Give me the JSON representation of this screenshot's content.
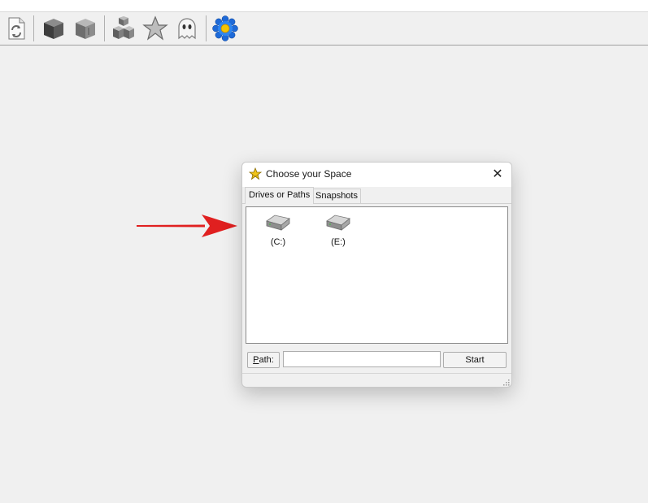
{
  "toolbar": {
    "buttons": [
      {
        "icon": "refresh-document-icon"
      },
      {
        "icon": "dark-cube-icon"
      },
      {
        "icon": "gray-cube-icon"
      },
      {
        "icon": "cubes-icon"
      },
      {
        "icon": "star-icon"
      },
      {
        "icon": "ghost-icon"
      },
      {
        "icon": "blue-flower-icon"
      }
    ]
  },
  "annotation": {
    "arrow_color": "#e02020"
  },
  "dialog": {
    "title": "Choose your Space",
    "close_label": "✕",
    "tabs": [
      {
        "label": "Drives or Paths",
        "active": true
      },
      {
        "label": "Snapshots",
        "active": false
      }
    ],
    "drives": [
      {
        "label": "(C:)",
        "icon": "hard-drive-icon"
      },
      {
        "label": "(E:)",
        "icon": "hard-drive-icon"
      }
    ],
    "path_label_underlined": "P",
    "path_label_rest": "ath:",
    "path_value": "",
    "start_label": "Start"
  },
  "colors": {
    "background": "#f0f0f0",
    "dialog_title_bg": "#ffffff",
    "accent_arrow": "#e02020"
  }
}
